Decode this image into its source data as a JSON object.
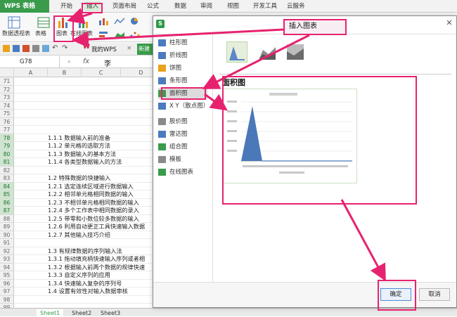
{
  "app": {
    "name": "WPS 表格"
  },
  "menu": [
    "开始",
    "插入",
    "页面布局",
    "公式",
    "数据",
    "审阅",
    "视图",
    "开发工具",
    "云服务"
  ],
  "ribbon": {
    "pivot_label": "数据透视表",
    "table_label": "表格",
    "chart_label": "图表",
    "online_chart_label": "在线图表"
  },
  "toolbar": {
    "mywps": "我的WPS",
    "new_tab": "新建"
  },
  "formula": {
    "cell_ref": "G78",
    "fx": "fx",
    "value": "李"
  },
  "columns": [
    "A",
    "B",
    "C",
    "D"
  ],
  "rows": [
    {
      "num": "71",
      "text": "",
      "sel": false
    },
    {
      "num": "72",
      "text": "",
      "sel": false
    },
    {
      "num": "73",
      "text": "",
      "sel": false
    },
    {
      "num": "74",
      "text": "",
      "sel": false
    },
    {
      "num": "75",
      "text": "",
      "sel": false
    },
    {
      "num": "76",
      "text": "",
      "sel": false
    },
    {
      "num": "77",
      "text": "",
      "sel": false
    },
    {
      "num": "78",
      "text": "1.1.1 数据输入前的准备",
      "sel": true
    },
    {
      "num": "79",
      "text": "1.1.2 单元格的选取方法",
      "sel": true
    },
    {
      "num": "80",
      "text": "1.1.3 数据输入的基本方法",
      "sel": true
    },
    {
      "num": "81",
      "text": "1.1.4 各类型数据输入的方法",
      "sel": true
    },
    {
      "num": "82",
      "text": "",
      "sel": false
    },
    {
      "num": "83",
      "text": "1.2 特殊数据的快捷输入",
      "sel": false
    },
    {
      "num": "84",
      "text": "1.2.1 选定连续区域进行数据输入",
      "sel": true
    },
    {
      "num": "85",
      "text": "1.2.2 相邻单元格相同数据的输入",
      "sel": true
    },
    {
      "num": "86",
      "text": "1.2.3 不相邻单元格相同数据的输入",
      "sel": true
    },
    {
      "num": "87",
      "text": "1.2.4 多个工作表中相同数据的录入",
      "sel": true
    },
    {
      "num": "88",
      "text": "1.2.5 带零和小数位较多数据的输入",
      "sel": false
    },
    {
      "num": "89",
      "text": "1.2.6 利用自动更正工具快速输入数据",
      "sel": false
    },
    {
      "num": "90",
      "text": "1.2.7 其他输入技巧介绍",
      "sel": false
    },
    {
      "num": "91",
      "text": "",
      "sel": false
    },
    {
      "num": "92",
      "text": "1.3 有规律数据的序列输入法",
      "sel": false
    },
    {
      "num": "93",
      "text": "1.3.1 拖动填充柄快速输入序列或者相",
      "sel": false
    },
    {
      "num": "94",
      "text": "1.3.2 根据输入前两个数据的规律快速",
      "sel": false
    },
    {
      "num": "95",
      "text": "1.3.3 自定义序列的应用",
      "sel": false
    },
    {
      "num": "96",
      "text": "1.3.4 快速输入复杂的序列号",
      "sel": false
    },
    {
      "num": "97",
      "text": "1.4 设置有效性对输入数据审核",
      "sel": false
    },
    {
      "num": "98",
      "text": "",
      "sel": false
    },
    {
      "num": "99",
      "text": "",
      "sel": false
    }
  ],
  "sheet_tabs": [
    "Sheet1",
    "Sheet2",
    "Sheet3"
  ],
  "dialog": {
    "categories": [
      "柱形图",
      "折线图",
      "饼图",
      "条形图",
      "面积图",
      "X Y（散点图）",
      "股价图",
      "雷达图",
      "组合图",
      "模板",
      "在线图表"
    ],
    "selected_index": 4,
    "preview_title": "面积图",
    "ok_label": "确定",
    "cancel_label": "取消"
  },
  "annotation": {
    "callout_text": "插入图表"
  },
  "colors": {
    "accent": "#e6226f",
    "wps_green": "#3a9b4b",
    "area_fill": "#4a78b8"
  }
}
